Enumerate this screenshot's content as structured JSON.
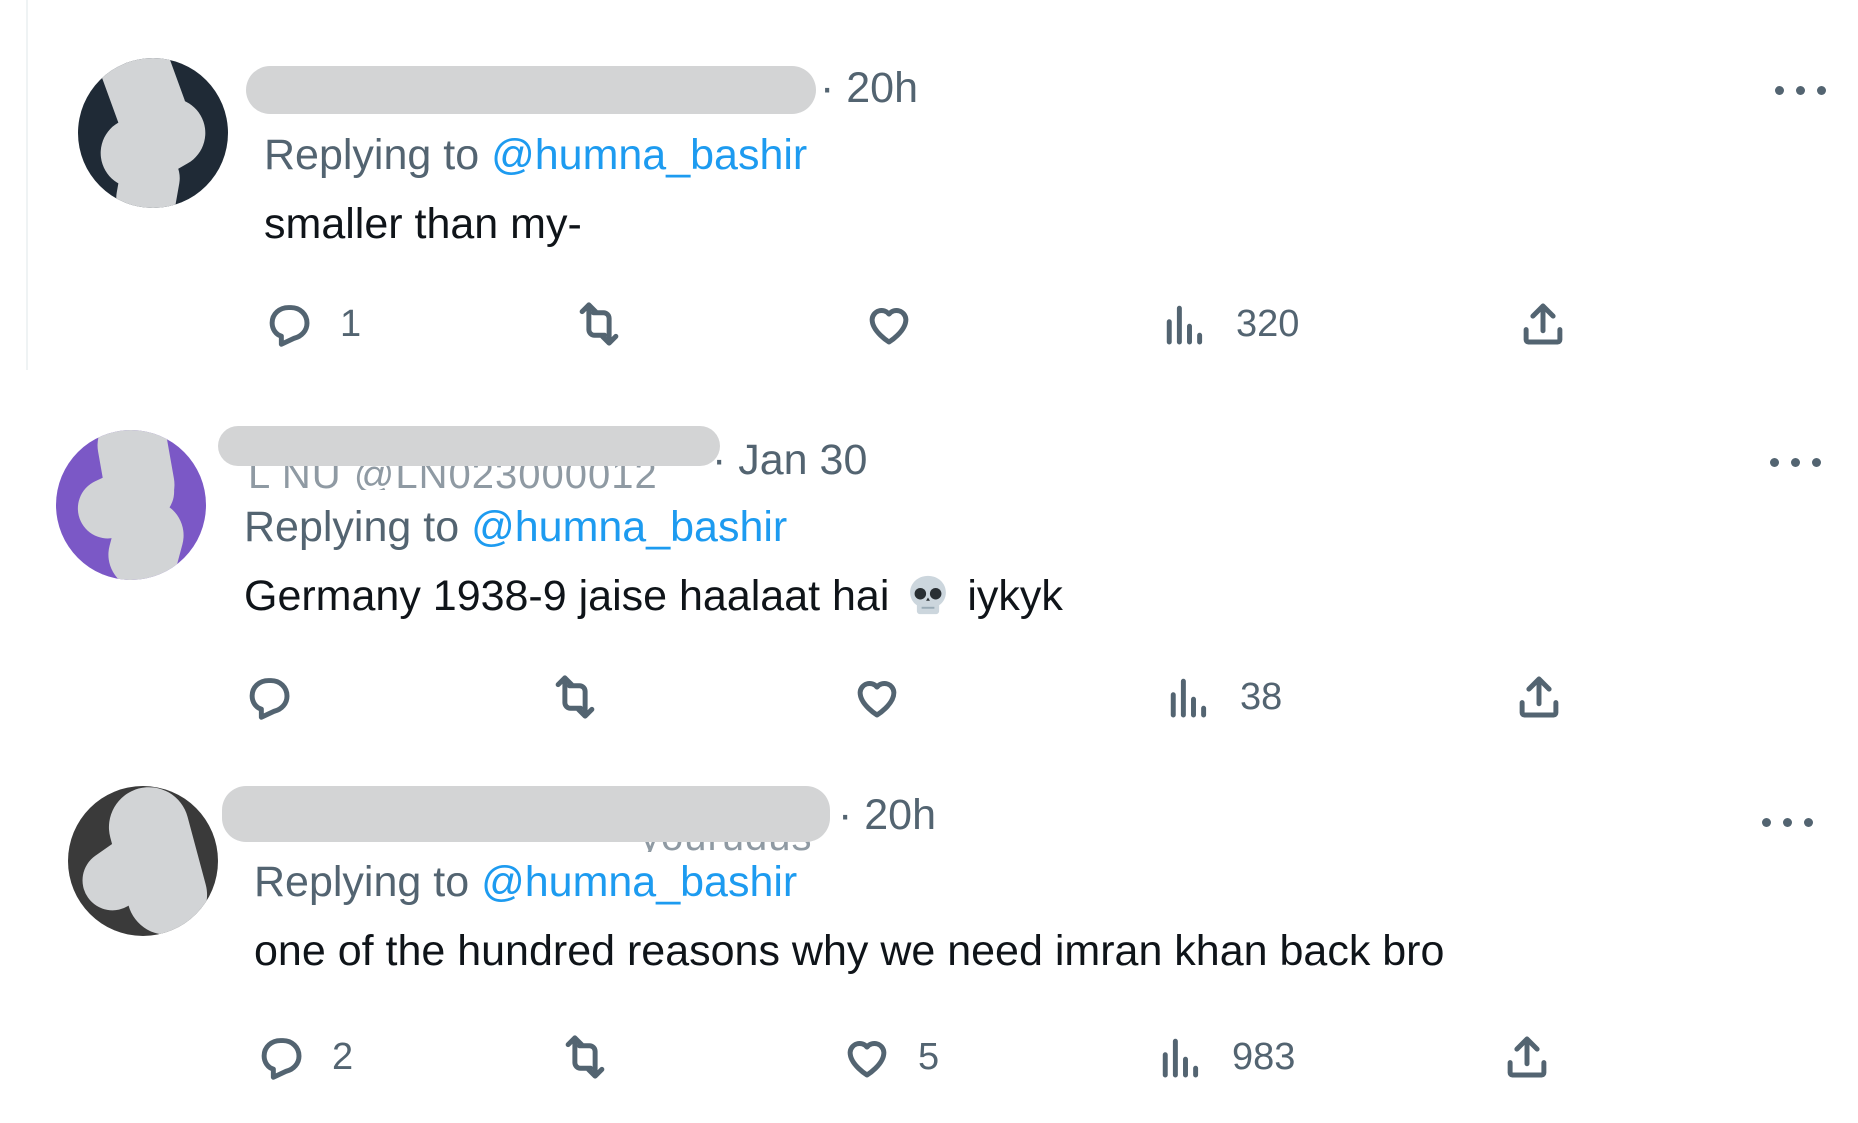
{
  "replies": [
    {
      "name_fragment": "",
      "time_label": "· 20h",
      "replying_prefix": "Replying to",
      "replying_handle": "@humna_bashir",
      "text": "smaller than my-",
      "text_after_emoji": "",
      "actions": {
        "reply_count": "1",
        "retweet_count": "",
        "like_count": "",
        "views_count": "320"
      },
      "avatar_color": "#1f2a36"
    },
    {
      "name_fragment": "L NU @LN023000012",
      "time_label": "· Jan 30",
      "replying_prefix": "Replying to",
      "replying_handle": "@humna_bashir",
      "text": "Germany 1938-9 jaise haalaat hai",
      "text_after_emoji": "iykyk",
      "emoji": "skull",
      "actions": {
        "reply_count": "",
        "retweet_count": "",
        "like_count": "",
        "views_count": "38"
      },
      "avatar_color": "#7b58c6"
    },
    {
      "name_fragment": "yourudus",
      "time_label": "· 20h",
      "replying_prefix": "Replying to",
      "replying_handle": "@humna_bashir",
      "text": "one of the hundred reasons why we need imran khan back bro",
      "text_after_emoji": "",
      "actions": {
        "reply_count": "2",
        "retweet_count": "",
        "like_count": "5",
        "views_count": "983"
      },
      "avatar_color": "#3a3a3a"
    }
  ],
  "colors": {
    "text_primary": "#0f1419",
    "text_secondary": "#536471",
    "link": "#1d9bf0",
    "redaction": "#d3d4d5"
  },
  "icons": [
    "reply-icon",
    "retweet-icon",
    "like-icon",
    "views-icon",
    "share-icon",
    "more-icon",
    "skull-emoji-icon"
  ]
}
